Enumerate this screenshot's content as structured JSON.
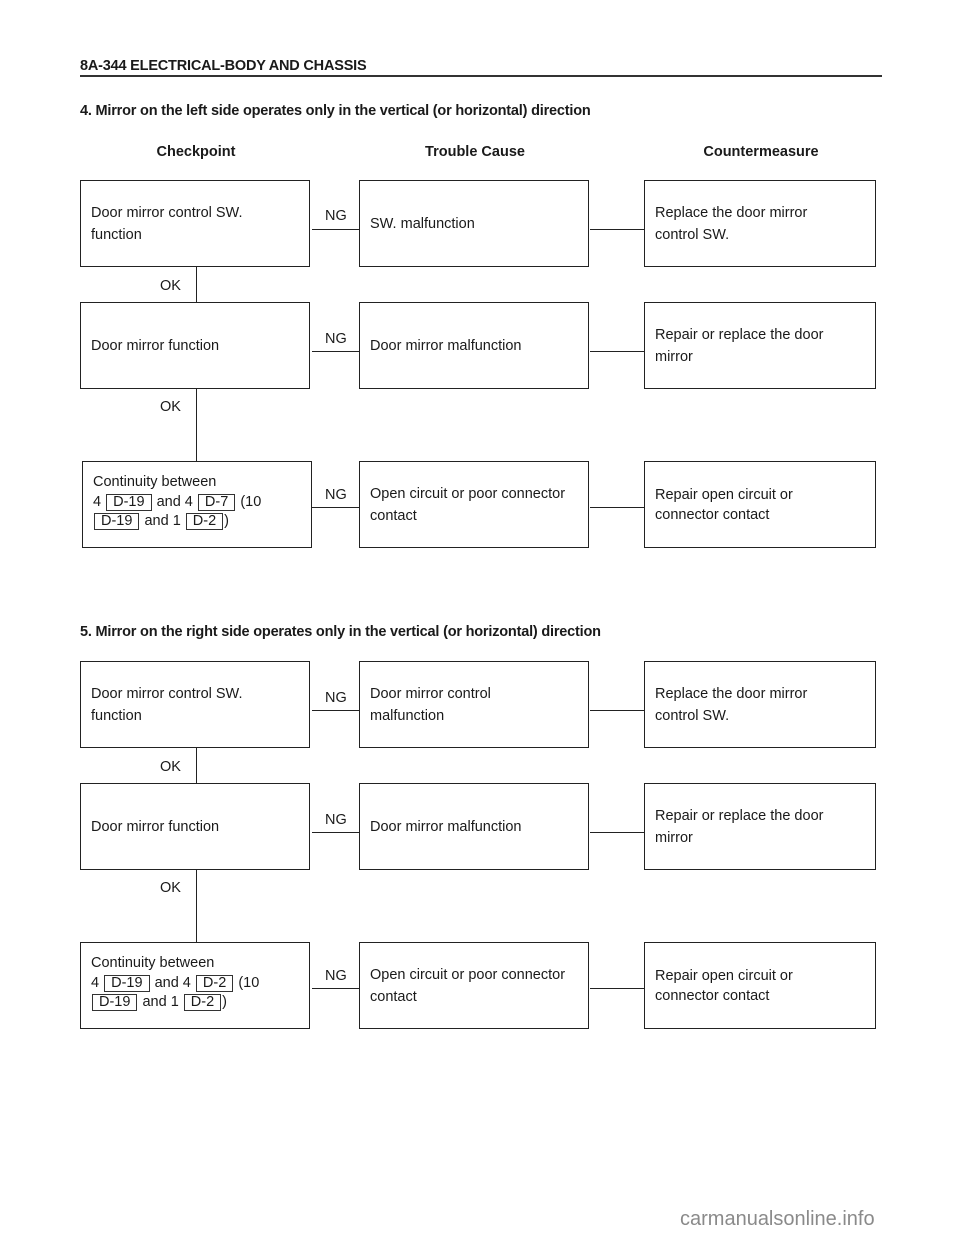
{
  "header": {
    "title": "8A-344  ELECTRICAL-BODY AND CHASSIS"
  },
  "columns": {
    "checkpoint": "Checkpoint",
    "trouble_cause": "Trouble Cause",
    "countermeasure": "Countermeasure"
  },
  "connectors": {
    "ok": "OK",
    "ng": "NG"
  },
  "sections": [
    {
      "title": "4.  Mirror on the left side operates only in the vertical (or horizontal) direction",
      "rows": [
        {
          "checkpoint": "Door mirror control SW.\nfunction",
          "cause": "SW. malfunction",
          "measure": "Replace the door mirror\ncontrol SW."
        },
        {
          "checkpoint": "Door mirror function",
          "cause": "Door mirror malfunction",
          "measure": "Repair or replace the door\nmirror"
        },
        {
          "checkpoint": {
            "line1": "Continuity between",
            "pin_a": "4",
            "ref_a": "D-19",
            "and_1": "and 4",
            "ref_b": "D-7",
            "paren": "(10",
            "ref_c": "D-19",
            "and_2": "and 1",
            "ref_d": "D-2",
            "close": ")"
          },
          "cause": "Open circuit or poor connector\ncontact",
          "measure": "Repair open circuit or\nconnector contact"
        }
      ]
    },
    {
      "title": "5.  Mirror on the right side operates only in the vertical (or horizontal) direction",
      "rows": [
        {
          "checkpoint": "Door mirror control SW.\nfunction",
          "cause": "Door mirror control\nmalfunction",
          "measure": "Replace the door mirror\ncontrol SW."
        },
        {
          "checkpoint": "Door mirror function",
          "cause": "Door mirror malfunction",
          "measure": "Repair or replace the door\nmirror"
        },
        {
          "checkpoint": {
            "line1": "Continuity between",
            "pin_a": "4",
            "ref_a": "D-19",
            "and_1": "and 4",
            "ref_b": "D-2",
            "paren": "(10",
            "ref_c": "D-19",
            "and_2": "and 1",
            "ref_d": "D-2",
            "close": ")"
          },
          "cause": "Open circuit or poor connector\ncontact",
          "measure": "Repair open circuit or\nconnector contact"
        }
      ]
    }
  ],
  "watermark": "carmanualsonline.info"
}
